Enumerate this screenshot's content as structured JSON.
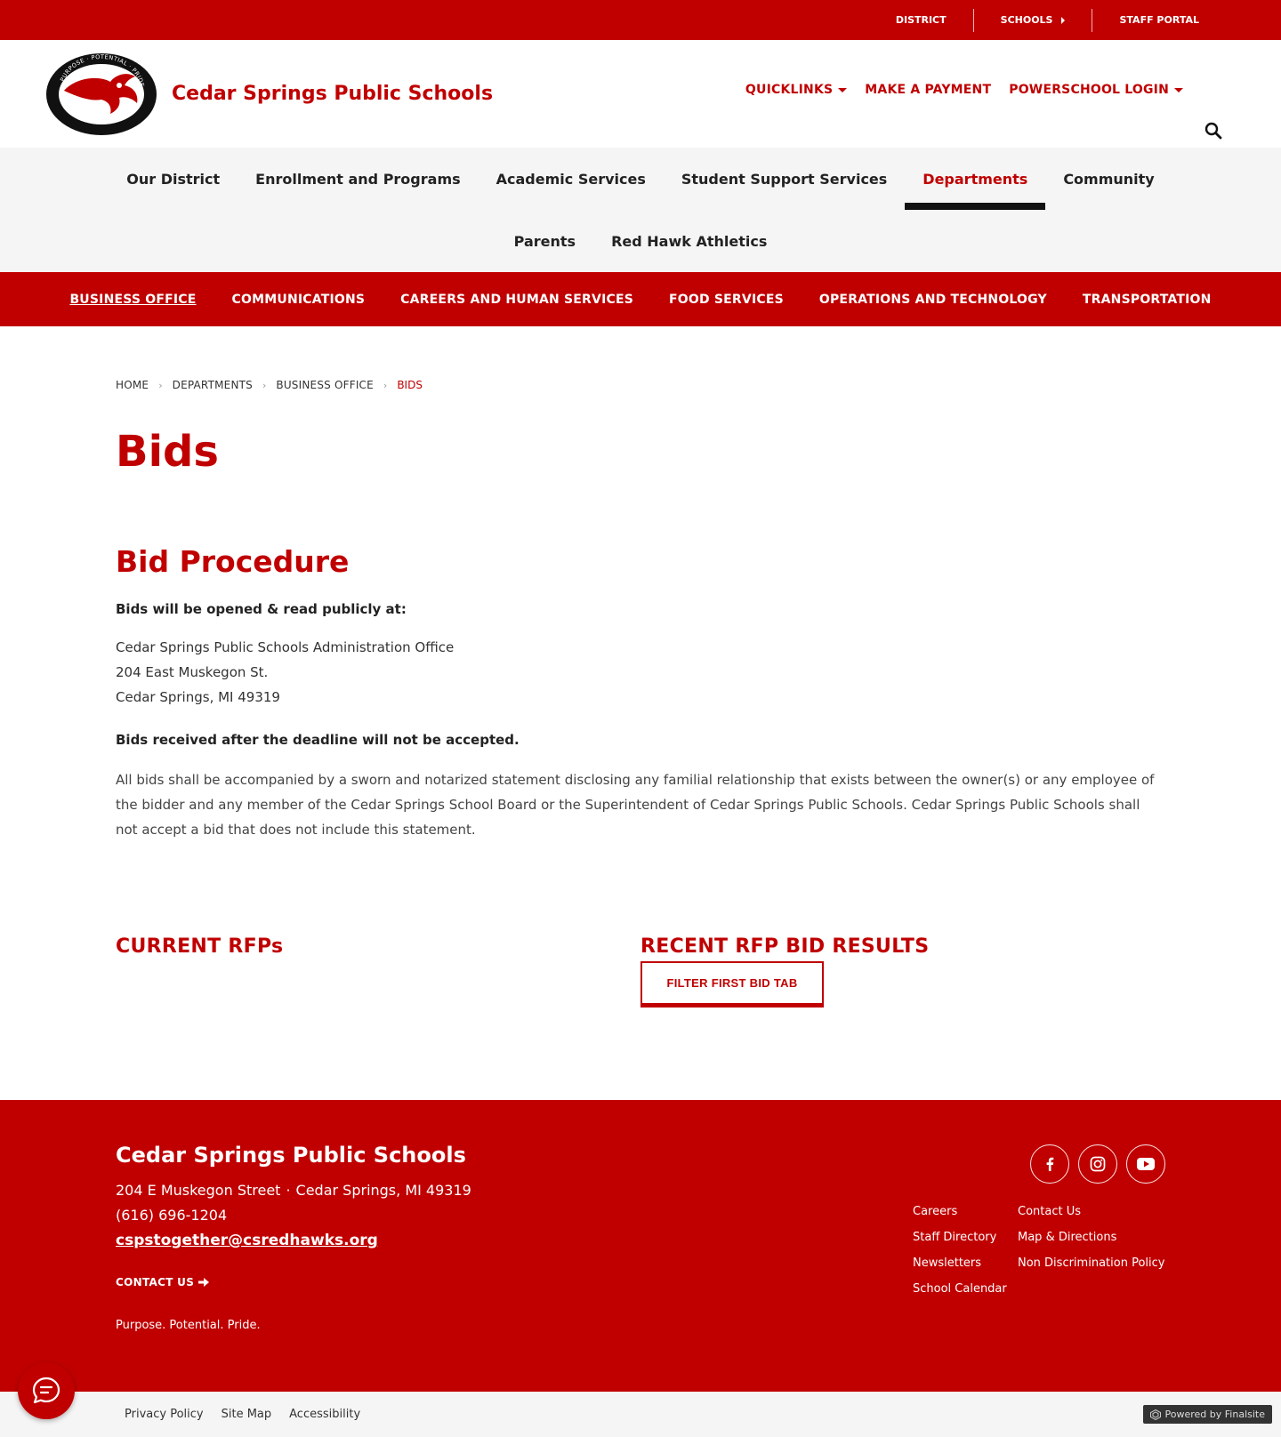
{
  "utility": {
    "district": "DISTRICT",
    "schools": "SCHOOLS",
    "staff_portal": "STAFF PORTAL"
  },
  "header": {
    "logo_text_top": "PURPOSE · POTENTIAL · PRIDE",
    "logo_text_bottom": "CEDAR SPRINGS PUBLIC SCHOOLS",
    "site_name": "Cedar Springs Public Schools",
    "links": {
      "quicklinks": "QUICKLINKS",
      "payment": "MAKE A PAYMENT",
      "powerschool": "POWERSCHOOL LOGIN"
    }
  },
  "nav": {
    "row1": [
      "Our District",
      "Enrollment and Programs",
      "Academic Services",
      "Student Support Services",
      "Departments",
      "Community"
    ],
    "row2": [
      "Parents",
      "Red Hawk Athletics"
    ]
  },
  "subnav": [
    "BUSINESS OFFICE",
    "COMMUNICATIONS",
    "CAREERS AND HUMAN SERVICES",
    "FOOD SERVICES",
    "OPERATIONS AND TECHNOLOGY",
    "TRANSPORTATION"
  ],
  "breadcrumb": [
    "HOME",
    "DEPARTMENTS",
    "BUSINESS OFFICE",
    "BIDS"
  ],
  "page": {
    "title": "Bids",
    "section_title": "Bid Procedure",
    "opened_heading": "Bids will be opened & read publicly at:",
    "address": [
      "Cedar Springs Public Schools Administration Office",
      "204 East Muskegon St.",
      "Cedar Springs, MI  49319"
    ],
    "deadline": "Bids received after the deadline will not be accepted.",
    "statement": "All bids shall be accompanied by a sworn and notarized statement disclosing any familial relationship that exists between the owner(s) or any employee of the bidder and any member of the Cedar Springs School Board or the Superintendent of Cedar Springs Public Schools. Cedar Springs Public Schools shall not accept a bid that does not include this statement.",
    "current_rfps": "CURRENT RFPs",
    "recent_results": "RECENT RFP BID RESULTS",
    "filter_button": "FILTER FIRST BID TAB"
  },
  "footer": {
    "name": "Cedar Springs Public Schools",
    "street": "204 E Muskegon Street",
    "city": "Cedar Springs, MI  49319",
    "phone": "(616) 696-1204",
    "email": "cspstogether@csredhawks.org",
    "contact": "CONTACT US",
    "tagline": "Purpose. Potential. Pride.",
    "links": [
      "Careers",
      "Contact Us",
      "Staff Directory",
      "Map & Directions",
      "Newsletters",
      "Non Discrimination Policy",
      "School Calendar"
    ]
  },
  "bottom": {
    "privacy": "Privacy Policy",
    "sitemap": "Site Map",
    "accessibility": "Accessibility",
    "powered": "Powered by Finalsite"
  },
  "colors": {
    "brand_red": "#c00000",
    "nav_bg": "#f5f5f5"
  }
}
